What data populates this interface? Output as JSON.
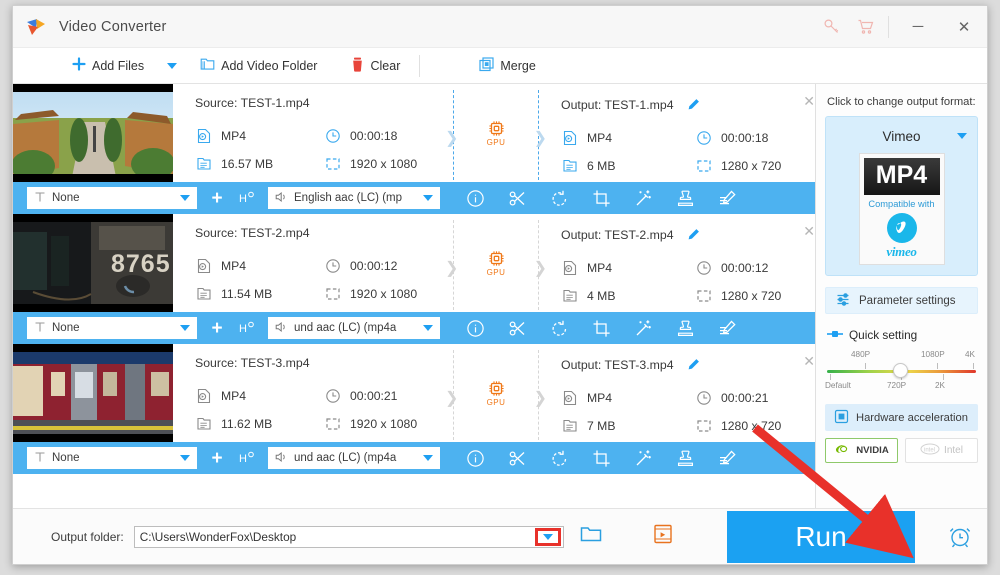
{
  "window": {
    "title": "Video Converter",
    "icons": {
      "key": "key-icon",
      "cart": "cart-icon",
      "minimize": "minimize-icon",
      "close": "close-icon"
    },
    "minimize_label": "─",
    "close_label": "✕"
  },
  "toolbar": {
    "add_files": "Add Files",
    "add_video_folder": "Add Video Folder",
    "clear": "Clear",
    "merge": "Merge"
  },
  "files": [
    {
      "source_label": "Source: TEST-1.mp4",
      "source_format": "MP4",
      "source_duration": "00:00:18",
      "source_size": "16.57 MB",
      "source_resolution": "1920 x 1080",
      "output_label": "Output: TEST-1.mp4",
      "output_format": "MP4",
      "output_duration": "00:00:18",
      "output_size": "6 MB",
      "output_resolution": "1280 x 720",
      "gpu_badge": "GPU",
      "subtitle_value": "None",
      "audio_value": "English aac (LC) (mp",
      "thumb_kind": "resort-path",
      "highlight": true
    },
    {
      "source_label": "Source: TEST-2.mp4",
      "source_format": "MP4",
      "source_duration": "00:00:12",
      "source_size": "11.54 MB",
      "source_resolution": "1920 x 1080",
      "output_label": "Output: TEST-2.mp4",
      "output_format": "MP4",
      "output_duration": "00:00:12",
      "output_size": "4 MB",
      "output_resolution": "1280 x 720",
      "gpu_badge": "GPU",
      "subtitle_value": "None",
      "audio_value": "und aac (LC) (mp4a",
      "thumb_kind": "dark-train",
      "highlight": false
    },
    {
      "source_label": "Source: TEST-3.mp4",
      "source_format": "MP4",
      "source_duration": "00:00:21",
      "source_size": "11.62 MB",
      "source_resolution": "1920 x 1080",
      "output_label": "Output: TEST-3.mp4",
      "output_format": "MP4",
      "output_duration": "00:00:21",
      "output_size": "7 MB",
      "output_resolution": "1280 x 720",
      "gpu_badge": "GPU",
      "subtitle_value": "None",
      "audio_value": "und aac (LC) (mp4a",
      "thumb_kind": "red-train",
      "highlight": false
    }
  ],
  "strip_icons": [
    "info-icon",
    "cut-icon",
    "rotate-icon",
    "crop-icon",
    "effect-icon",
    "watermark-icon",
    "subtitle-icon"
  ],
  "right_panel": {
    "hint": "Click to change output format:",
    "format_name": "Vimeo",
    "format_badge": "MP4",
    "compatible_text": "Compatible with",
    "vimeo_wordmark": "vimeo",
    "parameter_settings": "Parameter settings",
    "quick_setting": "Quick setting",
    "slider": {
      "top_labels": [
        "480P",
        "1080P",
        "4K"
      ],
      "bottom_labels": [
        "Default",
        "720P",
        "2K"
      ],
      "current": "720P"
    },
    "hardware_acceleration": "Hardware acceleration",
    "gpu_nvidia": "NVIDIA",
    "gpu_intel": "Intel"
  },
  "footer": {
    "output_folder_label": "Output folder:",
    "output_folder_path": "C:\\Users\\WonderFox\\Desktop",
    "output_folder_placeholder": "Output folder path",
    "run_label": "Run",
    "icons": {
      "dropdown": "chevron-down-icon",
      "folder": "folder-icon",
      "converted": "open-converted-icon",
      "alarm": "alarm-icon"
    }
  },
  "colors": {
    "accent": "#1ba1f2",
    "strip": "#4db2f0",
    "gpu_orange": "#f07818",
    "highlight_red": "#e8312a",
    "nvidia_green": "#76b900"
  }
}
